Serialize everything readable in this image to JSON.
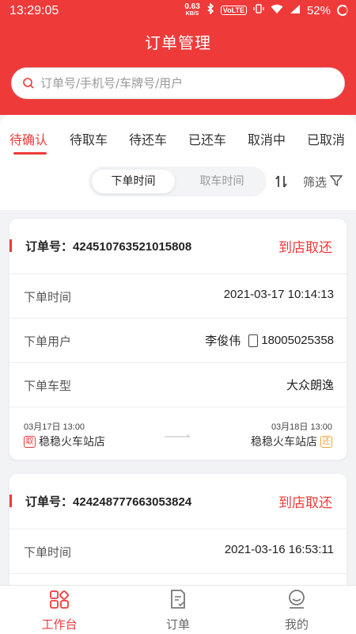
{
  "status_bar": {
    "time": "13:29:05",
    "speed": "0.63",
    "speed_unit": "KB/S",
    "network_badge": "VoLTE",
    "battery": "52%"
  },
  "header": {
    "title": "订单管理",
    "search_placeholder": "订单号/手机号/车牌号/用户"
  },
  "tabs": [
    {
      "label": "待确认",
      "active": true
    },
    {
      "label": "待取车",
      "active": false
    },
    {
      "label": "待还车",
      "active": false
    },
    {
      "label": "已还车",
      "active": false
    },
    {
      "label": "取消中",
      "active": false
    },
    {
      "label": "已取消",
      "active": false
    }
  ],
  "sort": {
    "options": [
      "下单时间",
      "取车时间"
    ],
    "selected": "下单时间",
    "filter_label": "筛选"
  },
  "orders": [
    {
      "order_label": "订单号：",
      "order_no": "424510763521015808",
      "mode": "到店取还",
      "rows": [
        {
          "label": "下单时间",
          "value": "2021-03-17 10:14:13"
        },
        {
          "label": "下单用户",
          "name": "李俊伟",
          "phone": "18005025358"
        },
        {
          "label": "下单车型",
          "value": "大众朗逸"
        }
      ],
      "pickup": {
        "time": "03月17日 13:00",
        "badge": "取",
        "store": "稳稳火车站店"
      },
      "return": {
        "time": "03月18日 13:00",
        "badge": "还",
        "store": "稳稳火车站店"
      }
    },
    {
      "order_label": "订单号：",
      "order_no": "424248777663053824",
      "mode": "到店取还",
      "rows": [
        {
          "label": "下单时间",
          "value": "2021-03-16 16:53:11"
        }
      ]
    }
  ],
  "bottom_nav": [
    {
      "label": "工作台",
      "icon": "grid-icon",
      "active": true
    },
    {
      "label": "订单",
      "icon": "order-doc-icon",
      "active": false
    },
    {
      "label": "我的",
      "icon": "profile-icon",
      "active": false
    }
  ],
  "colors": {
    "accent": "#ef3a3a",
    "return_badge": "#f0a53a"
  }
}
